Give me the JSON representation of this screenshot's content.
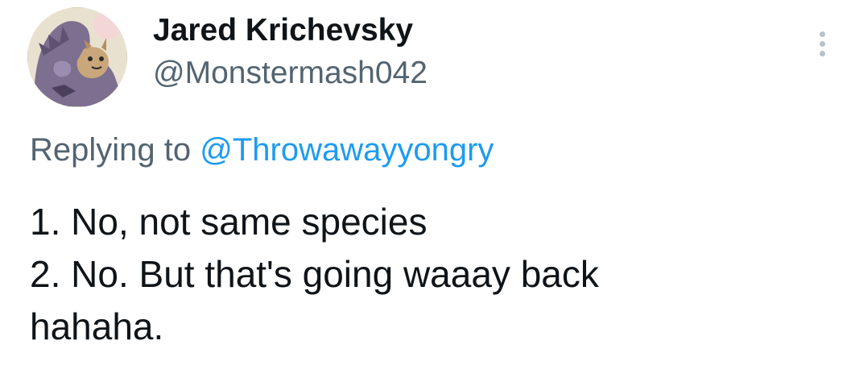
{
  "author": {
    "display_name": "Jared Krichevsky",
    "handle": "@Monstermash042",
    "avatar_icon": "avatar-monster-illustration"
  },
  "more_icon": "more-vertical-icon",
  "reply": {
    "prefix": "Replying to",
    "mention": "@Throwawayyongry"
  },
  "tweet": {
    "lines": [
      "1. No, not same species",
      "2. No. But that's going waaay back",
      "hahaha."
    ]
  },
  "colors": {
    "text_primary": "#0f1419",
    "text_secondary": "#536471",
    "link": "#1d9bf0",
    "background": "#ffffff"
  }
}
